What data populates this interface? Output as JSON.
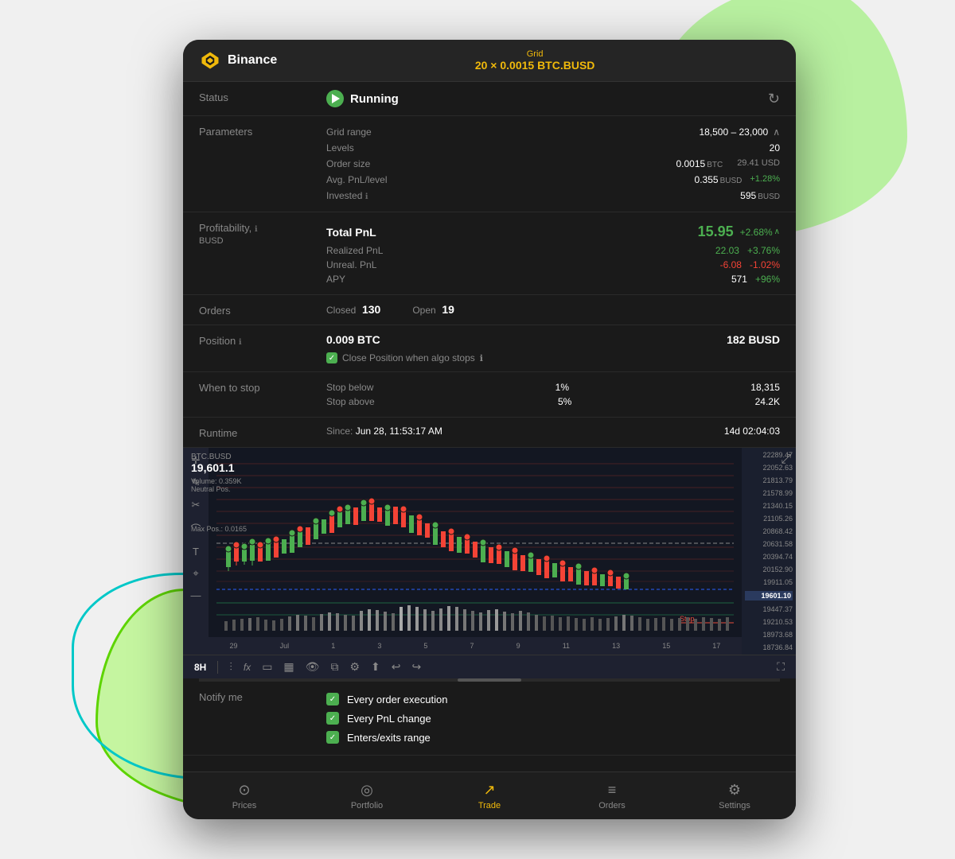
{
  "app": {
    "exchange": "Binance",
    "grid_label": "Grid",
    "grid_info": "20 × 0.0015 BTC.BUSD"
  },
  "status": {
    "label": "Status",
    "value": "Running"
  },
  "parameters": {
    "label": "Parameters",
    "grid_range_label": "Grid range",
    "grid_range_value": "18,500 – 23,000",
    "levels_label": "Levels",
    "levels_value": "20",
    "order_size_label": "Order size",
    "order_size_value": "0.0015",
    "order_size_unit": "BTC",
    "order_size_usd": "29.41 USD",
    "avg_pnl_label": "Avg. PnL/level",
    "avg_pnl_value": "0.355",
    "avg_pnl_unit": "BUSD",
    "avg_pnl_pct": "+1.28%",
    "invested_label": "Invested",
    "invested_value": "595",
    "invested_unit": "BUSD"
  },
  "profitability": {
    "label": "Profitability,",
    "sublabel": "BUSD",
    "total_pnl_label": "Total PnL",
    "total_pnl_value": "15.95",
    "total_pnl_pct": "+2.68%",
    "realized_label": "Realized PnL",
    "realized_value": "22.03",
    "realized_pct": "+3.76%",
    "unrealized_label": "Unreal. PnL",
    "unrealized_value": "-6.08",
    "unrealized_pct": "-1.02%",
    "apy_label": "APY",
    "apy_value": "571",
    "apy_pct": "+96%"
  },
  "orders": {
    "label": "Orders",
    "closed_label": "Closed",
    "closed_value": "130",
    "open_label": "Open",
    "open_value": "19"
  },
  "position": {
    "label": "Position",
    "btc_value": "0.009 BTC",
    "busd_value": "182 BUSD",
    "close_on_stop": "Close Position when algo stops"
  },
  "when_to_stop": {
    "label": "When to stop",
    "stop_below_label": "Stop below",
    "stop_below_pct": "1%",
    "stop_below_val": "18,315",
    "stop_above_label": "Stop above",
    "stop_above_pct": "5%",
    "stop_above_val": "24.2K"
  },
  "runtime": {
    "label": "Runtime",
    "since_label": "Since:",
    "since_value": "Jun 28, 11:53:17 AM",
    "duration": "14d 02:04:03"
  },
  "chart": {
    "pair": "BTC.BUSD",
    "price": "19,601.1",
    "timeframe": "8H",
    "volume_label": "Volume: 0.359K",
    "neutral_pos_label": "Neutral Pos.",
    "max_pos_label": "Max Pos.: 0.0165",
    "price_levels": [
      "22289.47",
      "22052.63",
      "21813.79",
      "21578.99",
      "21340.15",
      "21105.26",
      "20868.42",
      "20631.58",
      "20394.74",
      "20152.90",
      "19911.05",
      "19601.10",
      "19447.37",
      "19210.53",
      "18973.68",
      "18736.84"
    ],
    "time_labels": [
      "29",
      "Jul",
      "1",
      "3",
      "5",
      "7",
      "9",
      "11",
      "13",
      "15",
      "17"
    ]
  },
  "toolbar": {
    "timeframe": "8H",
    "tools": [
      "indicators",
      "fx",
      "rectangle",
      "chart-type",
      "eye",
      "layers",
      "settings",
      "share",
      "undo",
      "redo",
      "fullscreen"
    ]
  },
  "notify": {
    "label": "Notify me",
    "items": [
      "Every order execution",
      "Every PnL change",
      "Enters/exits range"
    ]
  },
  "bottom_nav": {
    "items": [
      {
        "label": "Prices",
        "icon": "⊙",
        "active": false
      },
      {
        "label": "Portfolio",
        "icon": "◎",
        "active": false
      },
      {
        "label": "Trade",
        "icon": "↗",
        "active": true
      },
      {
        "label": "Orders",
        "icon": "≡",
        "active": false
      },
      {
        "label": "Settings",
        "icon": "⚙",
        "active": false
      }
    ]
  }
}
